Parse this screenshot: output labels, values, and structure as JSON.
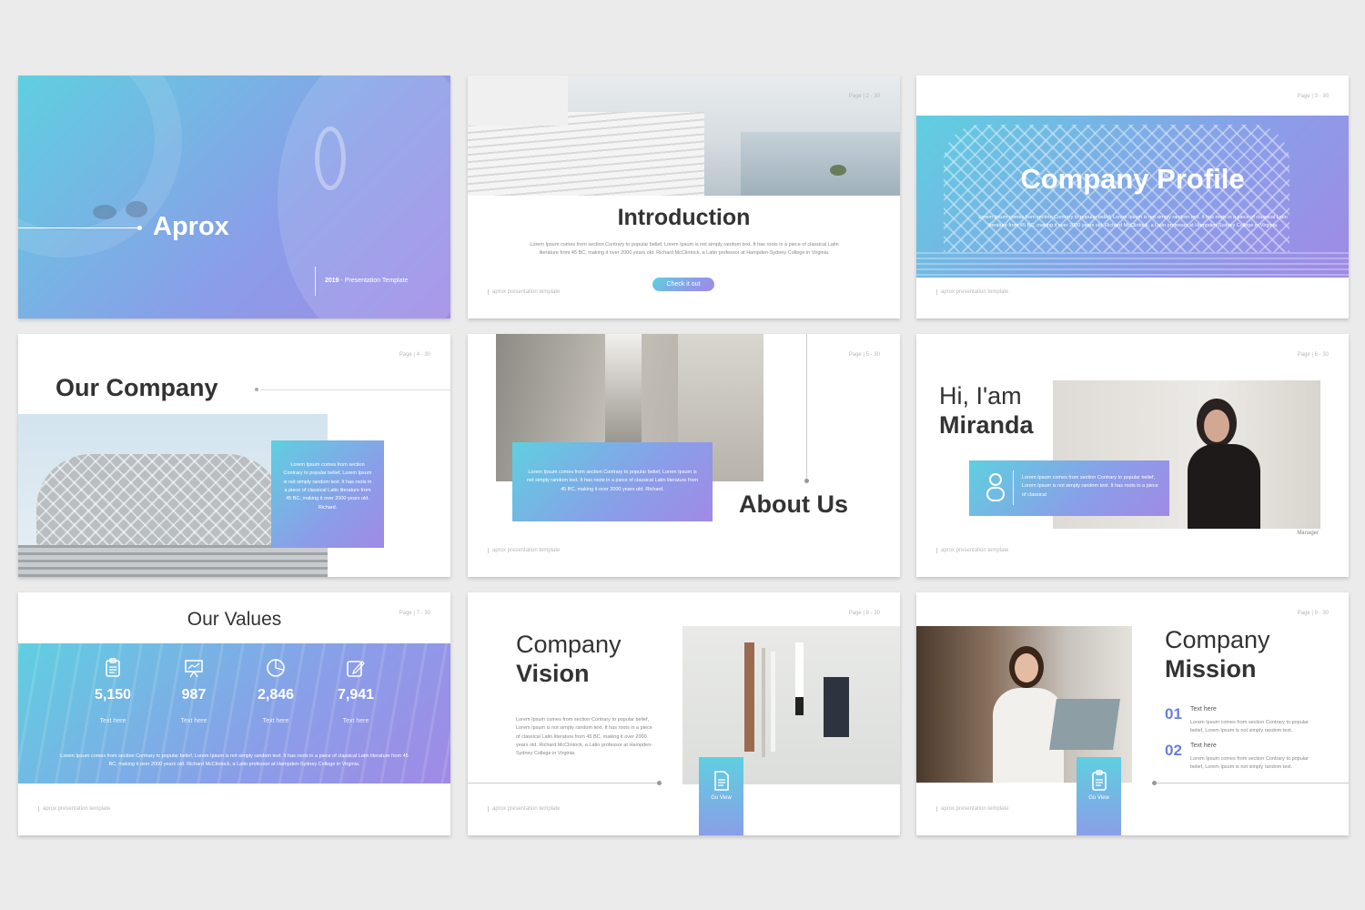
{
  "slides": {
    "s1": {
      "title": "Aprox",
      "year": "2019",
      "subtitle": "Presentation Template"
    },
    "s2": {
      "page": "Page | 2 - 30",
      "title": "Introduction",
      "body": "Lorem Ipsum comes from section Contrary to popular belief, Lorem Ipsum is not simply random text. It has roots in a piece of classical Latin literature from 45 BC, making it over 2000 years old. Richard McClintock, a Latin professor at Hampden-Sydney College in Virginia.",
      "button": "Check it out",
      "footer": "aprox presentation template"
    },
    "s3": {
      "page": "Page | 3 - 30",
      "title": "Company Profile",
      "body": "Lorem Ipsum comes from section Contrary to popular belief, Lorem Ipsum is not simply random text. It has roots in a piece of classical Latin literature from 45 BC, making it over 2000 years old. Richard McClintock, a Latin professor at Hampden-Sydney College in Virginia.",
      "footer": "aprox presentation template"
    },
    "s4": {
      "page": "Page | 4 - 30",
      "title": "Our Company",
      "body": "Lorem Ipsum comes from section Contrary to popular belief, Lorem Ipsum is not simply random text. It has roots in a piece of classical Latin literature from 45 BC, making it over 2000 years old. Richard."
    },
    "s5": {
      "page": "Page | 5 - 30",
      "title": "About Us",
      "body": "Lorem Ipsum comes from section Contrary to popular belief, Lorem Ipsum is not simply random text. It has roots in a piece of classical Latin literature from 45 BC, making it over 2000 years old. Richard.",
      "footer": "aprox presentation template"
    },
    "s6": {
      "page": "Page | 6 - 30",
      "greeting": "Hi, I'am",
      "name": "Miranda",
      "body": "Lorem Ipsum comes from section Contrary to popular belief, Lorem Ipsum is not simply random text. It has roots in a piece of classical",
      "role": "Manager",
      "footer": "aprox presentation template"
    },
    "s7": {
      "page": "Page | 7 - 30",
      "title": "Our Values",
      "stats": [
        {
          "value": "5,150",
          "label": "Text here",
          "icon": "clipboard-icon"
        },
        {
          "value": "987",
          "label": "Text here",
          "icon": "presentation-icon"
        },
        {
          "value": "2,846",
          "label": "Text here",
          "icon": "pie-chart-icon"
        },
        {
          "value": "7,941",
          "label": "Text here",
          "icon": "pencil-icon"
        }
      ],
      "body": "Lorem Ipsum comes from section Contrary to popular belief, Lorem Ipsum is not simply random text. It has roots in a piece of classical Latin literature from 45 BC, making it over 2000 years old. Richard McClintock, a Latin professor at Hampden-Sydney College in Virginia.",
      "footer": "aprox presentation template"
    },
    "s8": {
      "page": "Page | 8 - 30",
      "title_light": "Company",
      "title_bold": "Vision",
      "body": "Lorem Ipsum comes from section Contrary to popular belief, Lorem Ipsum is not simply random text. It has roots in a piece of classical Latin literature from 45 BC, making it over 2000 years old. Richard McClintock, a Latin professor at Hampden-Sydney College in Virginia.",
      "button": "Go View",
      "footer": "aprox presentation template"
    },
    "s9": {
      "page": "Page | 9 - 30",
      "title_light": "Company",
      "title_bold": "Mission",
      "items": [
        {
          "num": "01",
          "heading": "Text here",
          "body": "Lorem Ipsum comes from section Contrary to popular belief, Lorem Ipsum is not simply random text."
        },
        {
          "num": "02",
          "heading": "Text here",
          "body": "Lorem Ipsum comes from section Contrary to popular belief, Lorem Ipsum is not simply random text."
        }
      ],
      "button": "Go View",
      "footer": "aprox presentation template"
    }
  },
  "colors": {
    "accent_start": "#5fcfe0",
    "accent_end": "#a08ae6",
    "heading": "#333333",
    "number_accent": "#6b7fd8"
  }
}
